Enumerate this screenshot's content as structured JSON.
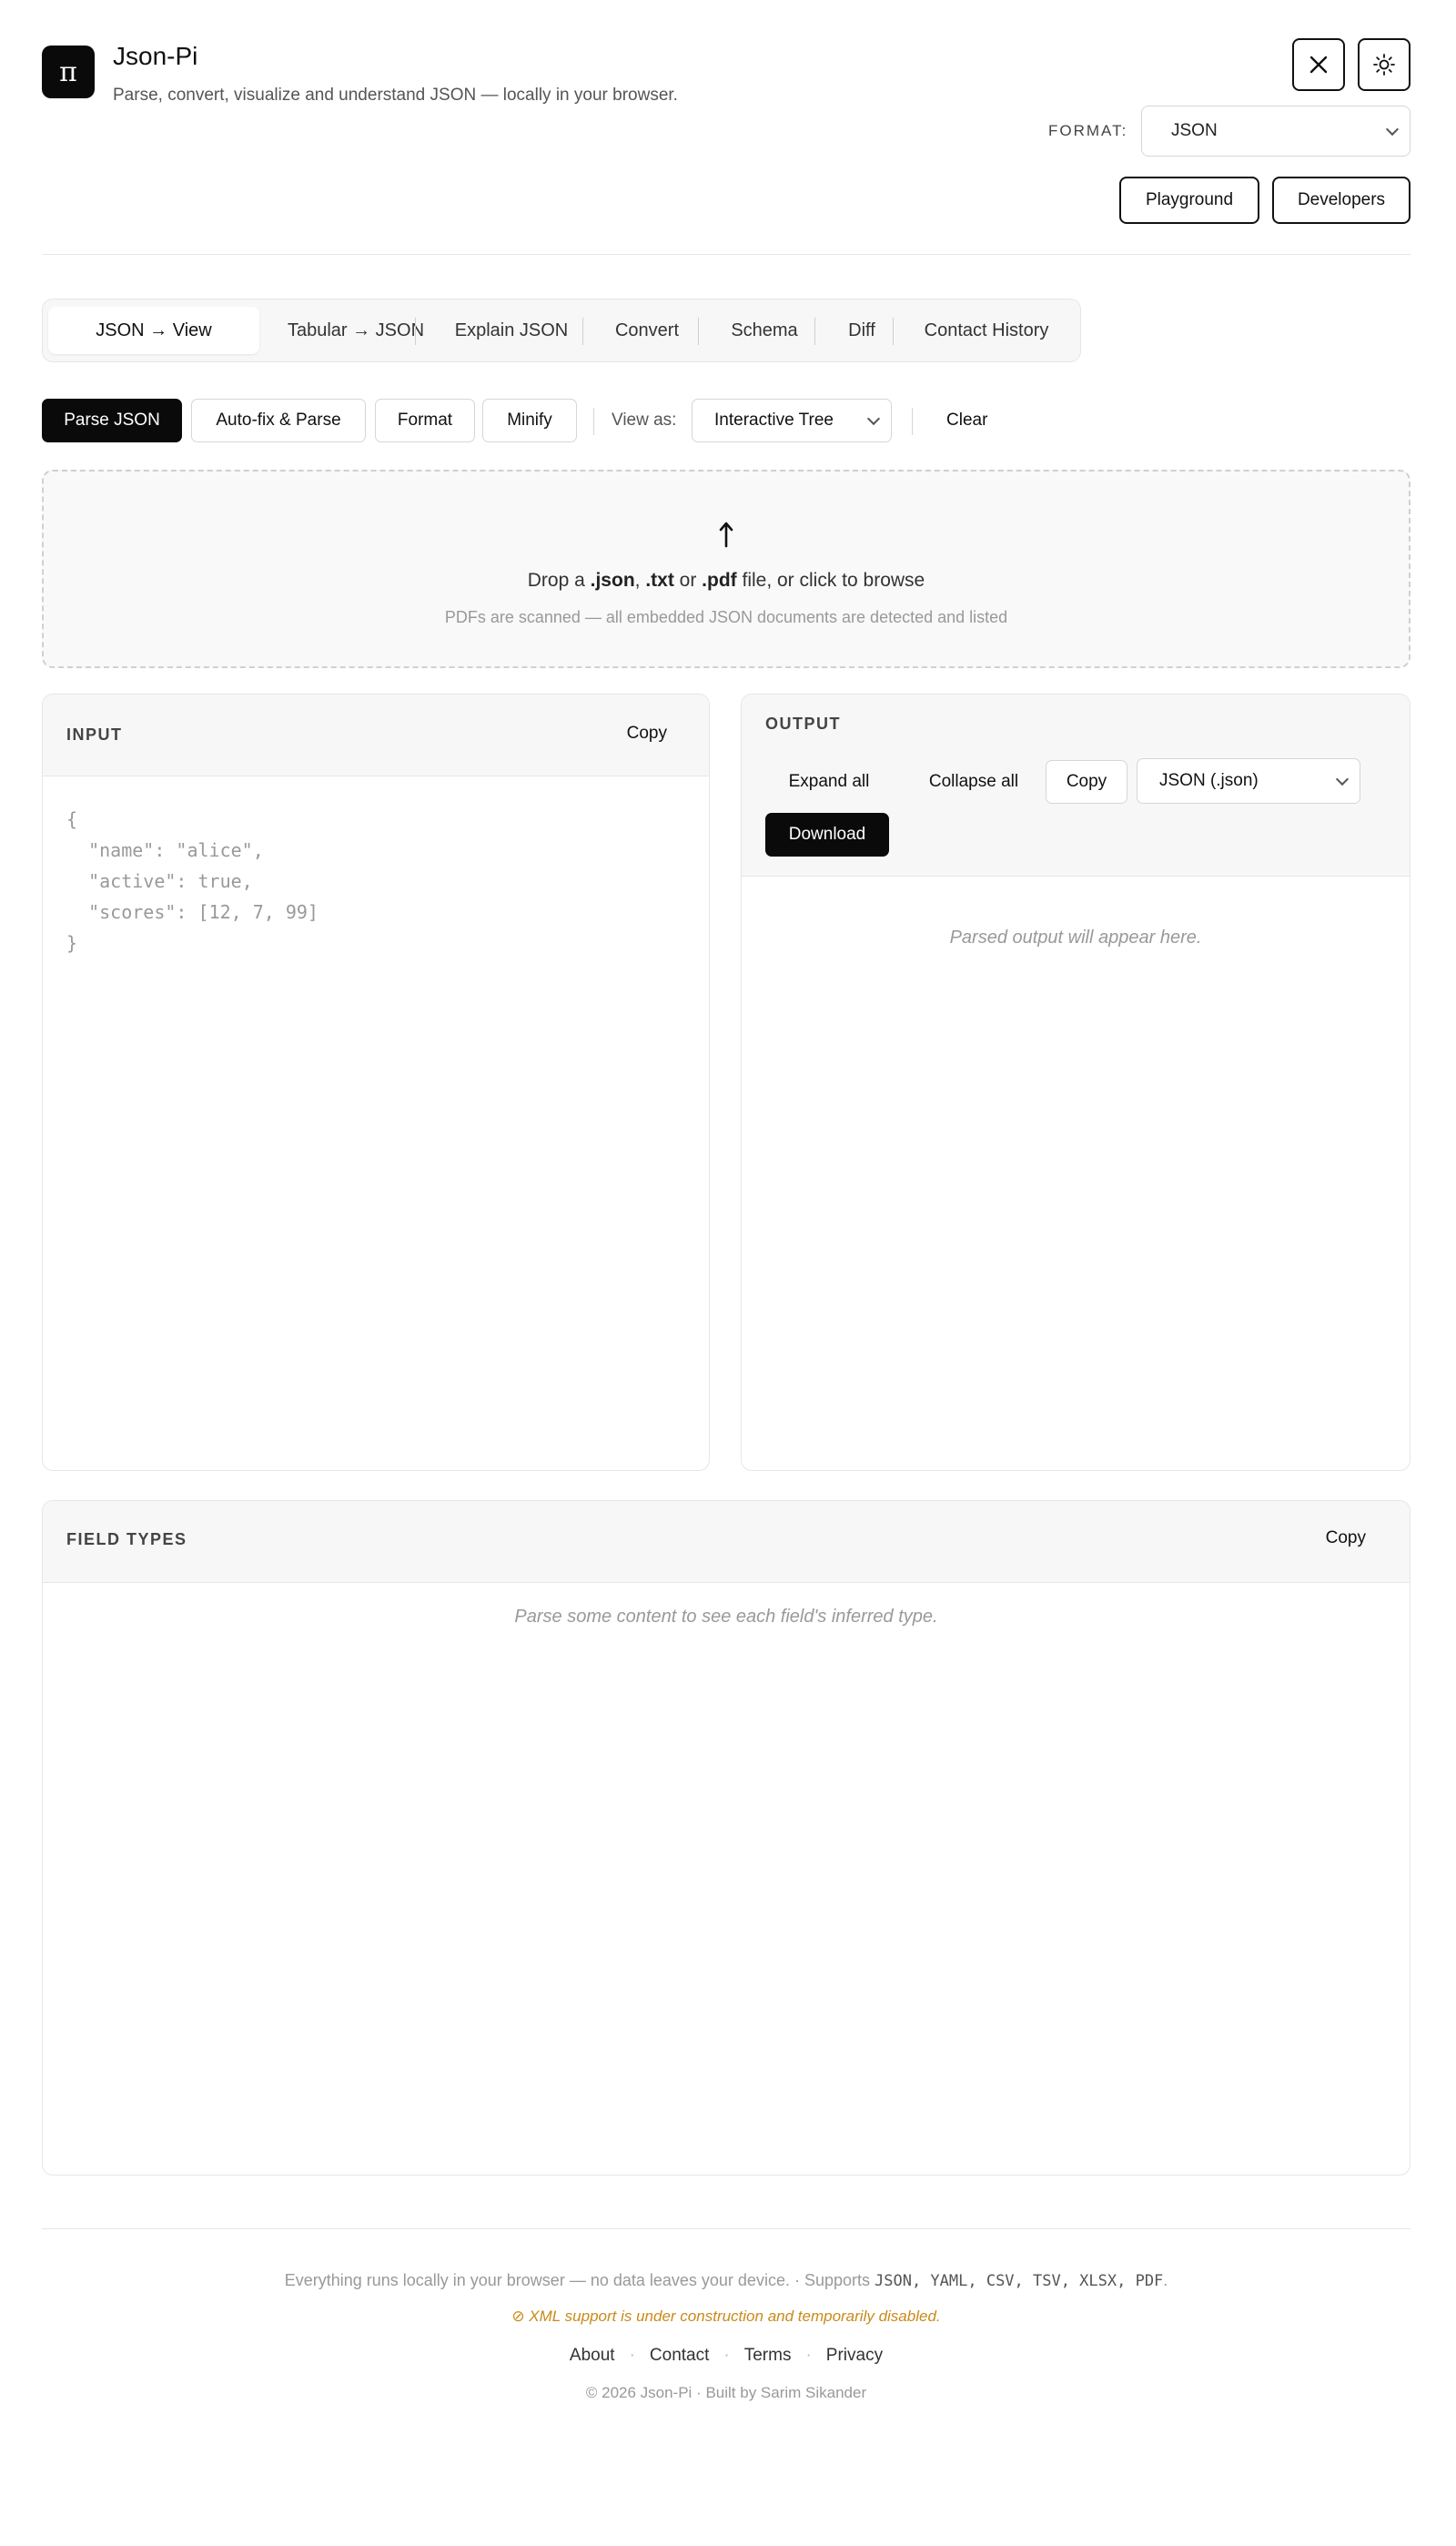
{
  "header": {
    "logo_glyph": "π",
    "title": "Json-Pi",
    "subtitle": "Parse, convert, visualize and understand JSON — locally in your browser.",
    "format_label": "FORMAT:",
    "format_value": "JSON",
    "playground_label": "Playground",
    "developers_label": "Developers",
    "close_icon": "close-icon",
    "theme_icon": "sun-icon"
  },
  "tabs": [
    {
      "label": "JSON → View",
      "active": true
    },
    {
      "label": "Tabular → JSON",
      "active": false
    },
    {
      "label": "Explain JSON",
      "active": false
    },
    {
      "label": "Convert",
      "active": false
    },
    {
      "label": "Schema",
      "active": false
    },
    {
      "label": "Diff",
      "active": false
    },
    {
      "label": "Contact History",
      "active": false
    }
  ],
  "toolbar": {
    "parse_label": "Parse JSON",
    "autofix_label": "Auto-fix & Parse",
    "format_label": "Format",
    "minify_label": "Minify",
    "view_as_label": "View as:",
    "view_as_value": "Interactive Tree",
    "clear_label": "Clear"
  },
  "dropzone": {
    "icon": "upload-arrow-icon",
    "text_prefix": "Drop a ",
    "ext1": ".json",
    "sep1": ", ",
    "ext2": ".txt",
    "sep2": " or ",
    "ext3": ".pdf",
    "text_suffix": " file, or click to browse",
    "subtext": "PDFs are scanned — all embedded JSON documents are detected and listed"
  },
  "input_panel": {
    "title": "INPUT",
    "copy_label": "Copy",
    "placeholder_code": "{\n  \"name\": \"alice\",\n  \"active\": true,\n  \"scores\": [12, 7, 99]\n}"
  },
  "output_panel": {
    "title": "OUTPUT",
    "expand_label": "Expand all",
    "collapse_label": "Collapse all",
    "copy_label": "Copy",
    "export_value": "JSON (.json)",
    "download_label": "Download",
    "placeholder": "Parsed output will appear here."
  },
  "field_types_panel": {
    "title": "FIELD TYPES",
    "copy_label": "Copy",
    "placeholder": "Parse some content to see each field's inferred type."
  },
  "footer": {
    "local_note": "Everything runs locally in your browser — no data leaves your device.",
    "separator": " · ",
    "supports_prefix": "Supports ",
    "formats": "JSON, YAML, CSV, TSV, XLSX, PDF",
    "supports_suffix": ".",
    "xml_warning": "⊘ XML support is under construction and temporarily disabled.",
    "links": [
      "About",
      "Contact",
      "Terms",
      "Privacy"
    ],
    "copyright": "© 2026 Json-Pi · Built by Sarim Sikander"
  }
}
